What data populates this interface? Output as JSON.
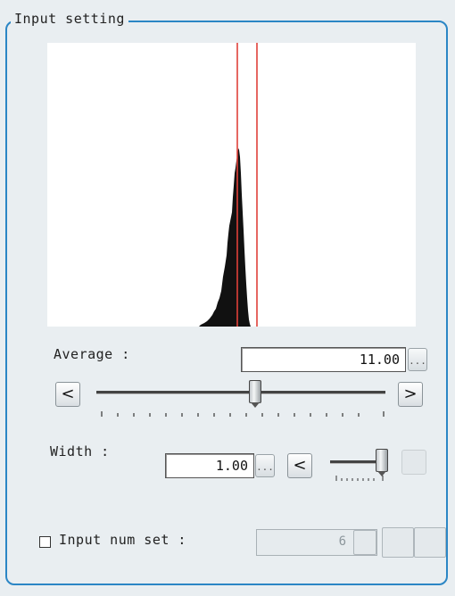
{
  "group": {
    "title": "Input setting"
  },
  "histogram": {
    "lower_marker_value": 10.0,
    "upper_marker_value": 12.0
  },
  "average": {
    "label": "Average :",
    "value": "11.00",
    "ellipsis": "...",
    "slider_value_fraction": 0.55
  },
  "width": {
    "label": "Width :",
    "value": "1.00",
    "ellipsis": "...",
    "slider_value_fraction": 0.95
  },
  "input_num": {
    "label": "Input num set :",
    "checked": false,
    "value": "6"
  },
  "arrows": {
    "left": "<",
    "right": ">"
  },
  "colors": {
    "frame": "#2b86c5",
    "marker": "#e0413a",
    "histogram_bars": "#111111"
  }
}
